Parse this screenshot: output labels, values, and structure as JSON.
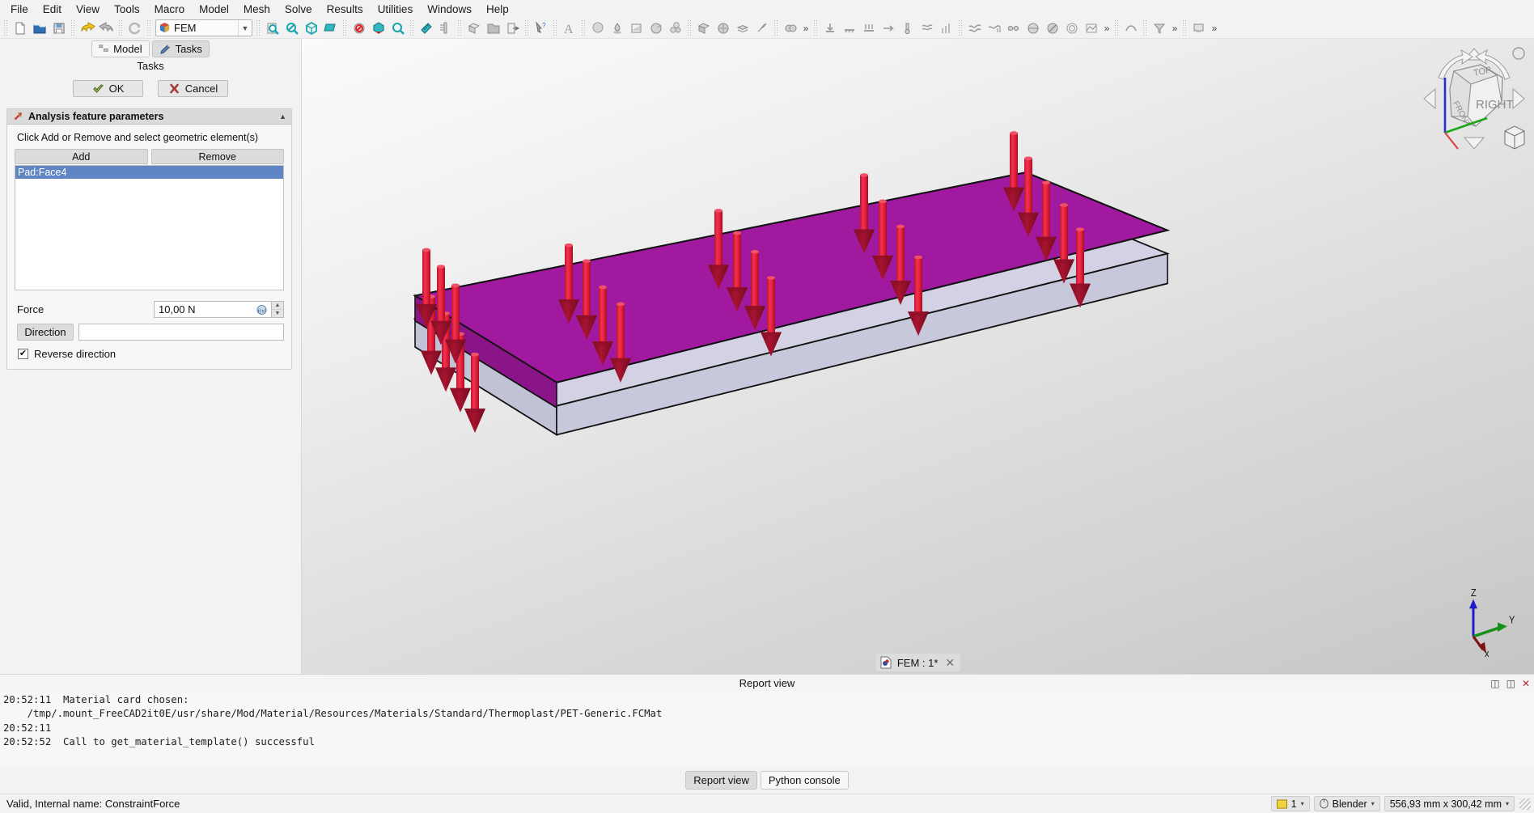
{
  "menubar": {
    "items": [
      {
        "label": "File",
        "accel": "F"
      },
      {
        "label": "Edit",
        "accel": "E"
      },
      {
        "label": "View",
        "accel": "V"
      },
      {
        "label": "Tools",
        "accel": "T"
      },
      {
        "label": "Macro",
        "accel": "M"
      },
      {
        "label": "Model",
        "accel": "o"
      },
      {
        "label": "Mesh",
        "accel": "e"
      },
      {
        "label": "Solve",
        "accel": "S"
      },
      {
        "label": "Results",
        "accel": "R"
      },
      {
        "label": "Utilities",
        "accel": ""
      },
      {
        "label": "Windows",
        "accel": "W"
      },
      {
        "label": "Help",
        "accel": "H"
      }
    ]
  },
  "toolbar": {
    "workbench_value": "FEM",
    "workbench_icon": "workbench-cube-icon",
    "more_label": "»",
    "icons": [
      "new-document-icon",
      "open-folder-icon",
      "save-icon",
      "undo-arrow-icon",
      "redo-arrow-icon",
      "refresh-icon"
    ],
    "view_icons": [
      "fit-all-icon",
      "fit-selection-icon",
      "isometric-view-icon",
      "draw-style-icon",
      "no-selection-icon",
      "axonometric-icon",
      "zoom-refresh-icon",
      "measure-ruler-icon",
      "caliper-icon",
      "part-box-icon",
      "folder-icon",
      "export-icon",
      "whats-this-icon",
      "text-icon",
      "sphere-icon",
      "material-drop-icon",
      "shape-icon",
      "plug-icon",
      "spheres-icon",
      "mesh-box-icon",
      "mesh-refine-icon",
      "layers-icon",
      "rocket-icon",
      "constraint-icon",
      "constraint-force-icon",
      "constraint-fixed-icon",
      "constraint-pressure-icon",
      "constraint-displacement-icon",
      "constraint-temperature-icon",
      "flow-icon",
      "electro-icon",
      "result-icon",
      "solver-icon",
      "post-pipeline-icon",
      "clip-icon",
      "cut-icon",
      "contours-icon",
      "data-along-line-icon",
      "warp-icon"
    ]
  },
  "panel": {
    "tabs": [
      {
        "label": "Model",
        "active": false,
        "icon": "model-tree-icon"
      },
      {
        "label": "Tasks",
        "active": true,
        "icon": "pencil-icon"
      }
    ],
    "caption": "Tasks",
    "ok_label": "OK",
    "cancel_label": "Cancel",
    "group": {
      "icon": "force-constraint-icon",
      "title": "Analysis feature parameters",
      "collapse_glyph": "▲",
      "hint": "Click Add or Remove and select geometric element(s)",
      "add_label": "Add",
      "remove_label": "Remove",
      "references": [
        {
          "label": "Pad:Face4",
          "selected": true
        }
      ],
      "force_label": "Force",
      "force_value": "10,00 N",
      "force_expression_icon": "expression-editor-icon",
      "direction_label": "Direction",
      "direction_value": "",
      "reverse_label": "Reverse direction",
      "reverse_checked": true,
      "check_glyph": "✔"
    }
  },
  "view3d": {
    "navcube": {
      "top_label": "TOP",
      "front_label": "FRONT",
      "right_label": "RIGHT"
    },
    "axes": {
      "x": "x",
      "y": "Y",
      "z": "Z"
    },
    "document_tab": {
      "label": "FEM : 1*",
      "icon": "freecad-document-icon",
      "close_glyph": "✕"
    },
    "colors": {
      "face_highlight": "#a0199e",
      "side_face": "#d2d2e4",
      "arrow": "#e8203c",
      "arrow_dark": "#8e1026",
      "background_top": "#fbfbfb",
      "background_bottom": "#c6c6c6"
    }
  },
  "report": {
    "title": "Report view",
    "restore_glyph": "❐",
    "float_glyph": "❐",
    "close_glyph": "✕",
    "lines": [
      "20:52:11  Material card chosen:",
      "    /tmp/.mount_FreeCAD2it0E/usr/share/Mod/Material/Resources/Materials/Standard/Thermoplast/PET-Generic.FCMat",
      "20:52:11",
      "20:52:52  Call to get_material_template() successful"
    ],
    "bottom_tabs": [
      {
        "label": "Report view",
        "active": true
      },
      {
        "label": "Python console",
        "active": false
      }
    ]
  },
  "statusbar": {
    "message": "Valid, Internal name: ConstraintForce",
    "chips": [
      {
        "icon": "layer-color-icon",
        "label": "1",
        "arrow": "▾"
      },
      {
        "icon": "mouse-icon",
        "label": "Blender",
        "arrow": "▾"
      },
      {
        "icon": "",
        "label": "556,93 mm x 300,42 mm",
        "arrow": "▾"
      }
    ]
  }
}
